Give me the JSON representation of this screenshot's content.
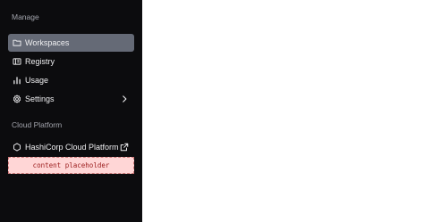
{
  "sidebar": {
    "sections": [
      {
        "title": "Manage",
        "items": [
          {
            "label": "Workspaces",
            "icon": "folder-icon",
            "active": true
          },
          {
            "label": "Registry",
            "icon": "registry-icon"
          },
          {
            "label": "Usage",
            "icon": "bar-chart-icon"
          },
          {
            "label": "Settings",
            "icon": "gear-icon",
            "trailing_icon": "chevron-right-icon"
          }
        ]
      },
      {
        "title": "Cloud Platform",
        "items": [
          {
            "label": "HashiCorp Cloud Platform",
            "icon": "hexagon-icon",
            "trailing_icon": "external-link-icon"
          }
        ]
      }
    ],
    "placeholder": "content placeholder"
  },
  "colors": {
    "sidebar_bg": "#0c0c0e",
    "active_item_bg": "#656a76",
    "section_title": "#a3a5ad",
    "item_text": "#efeff1",
    "placeholder_bg": "#ffd6d6",
    "placeholder_text": "#9b1c1c"
  }
}
